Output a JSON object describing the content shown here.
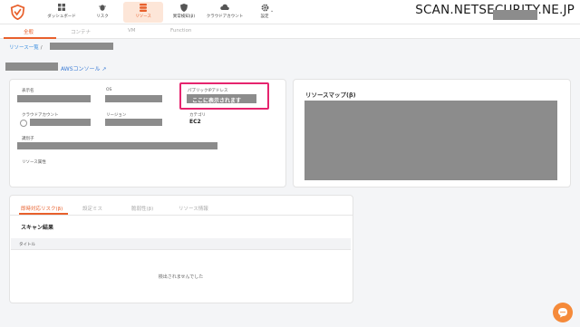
{
  "colors": {
    "accent": "#e8602c",
    "link": "#3a8ee0",
    "highlight_border": "#e6246e",
    "redacted": "#8c8c8c"
  },
  "nav": {
    "items": [
      {
        "label": "ダッシュボード",
        "icon": "grid-icon"
      },
      {
        "label": "リスク",
        "icon": "bug-icon"
      },
      {
        "label": "リソース",
        "icon": "database-icon",
        "active": true
      },
      {
        "label": "異常検知(β)",
        "icon": "shield-icon"
      },
      {
        "label": "クラウドアカウント",
        "icon": "cloud-icon"
      },
      {
        "label": "設定",
        "icon": "gear-icon"
      }
    ],
    "watermark": "SCAN.NETSECURITY.NE.JP"
  },
  "subtabs": [
    "全般",
    "コンテナ",
    "VM",
    "Function"
  ],
  "breadcrumb": {
    "root": "リソース一覧",
    "sep": "/"
  },
  "aws_console_link": "AWSコンソール",
  "resource": {
    "labels": {
      "display_name": "表示名",
      "os": "OS",
      "public_ip": "パブリックIPアドレス",
      "cloud_account": "クラウドアカウント",
      "region": "リージョン",
      "category": "カテゴリ",
      "identifier": "識別子",
      "attributes": "リソース属性"
    },
    "category_value": "EC2",
    "public_ip_note": "ここに表示されます"
  },
  "resource_map_title": "リソースマップ(β)",
  "risk_tabs": [
    "即時対応リスク(β)",
    "設定ミス",
    "脆弱性(β)",
    "リソース情報"
  ],
  "scan": {
    "title": "スキャン結果",
    "column": "タイトル",
    "empty_message": "検出されませんでした"
  }
}
